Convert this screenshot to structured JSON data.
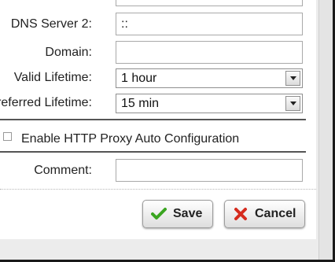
{
  "form": {
    "dns_server_2": {
      "label": "DNS Server 2:",
      "value": "::"
    },
    "domain": {
      "label": "Domain:",
      "value": ""
    },
    "valid_lifetime": {
      "label": "Valid Lifetime:",
      "value": "1 hour"
    },
    "preferred_lifetime": {
      "label": "Preferred Lifetime:",
      "value": "15 min"
    },
    "http_proxy_auto_config": {
      "label": "Enable HTTP Proxy Auto Configuration",
      "checked": false
    },
    "comment": {
      "label": "Comment:",
      "value": ""
    }
  },
  "buttons": {
    "save_label": "Save",
    "cancel_label": "Cancel"
  },
  "icons": {
    "save": "check-icon",
    "cancel": "x-icon"
  },
  "colors": {
    "save_check": "#3aa520",
    "cancel_x": "#d62b1e"
  }
}
